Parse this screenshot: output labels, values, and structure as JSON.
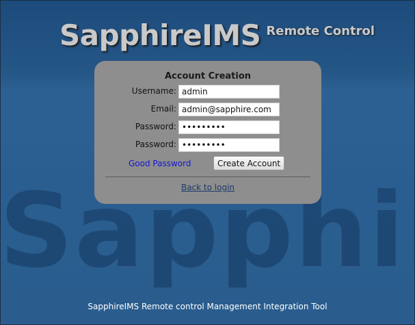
{
  "watermark": "Sapphire",
  "brand": {
    "name": "SapphireIMS",
    "subtitle": "Remote Control"
  },
  "form": {
    "title": "Account Creation",
    "fields": [
      {
        "label": "Username:",
        "value": "admin",
        "type": "text"
      },
      {
        "label": "Email:",
        "value": "admin@sapphire.com",
        "type": "text"
      },
      {
        "label": "Password:",
        "value": "•••••••••",
        "type": "password"
      },
      {
        "label": "Password:",
        "value": "•••••••••",
        "type": "password"
      }
    ],
    "strength_text": "Good Password",
    "strength_color": "#1515d4",
    "submit_label": "Create Account",
    "back_link": "Back to login"
  },
  "footer": "SapphireIMS Remote control Management Integration Tool"
}
